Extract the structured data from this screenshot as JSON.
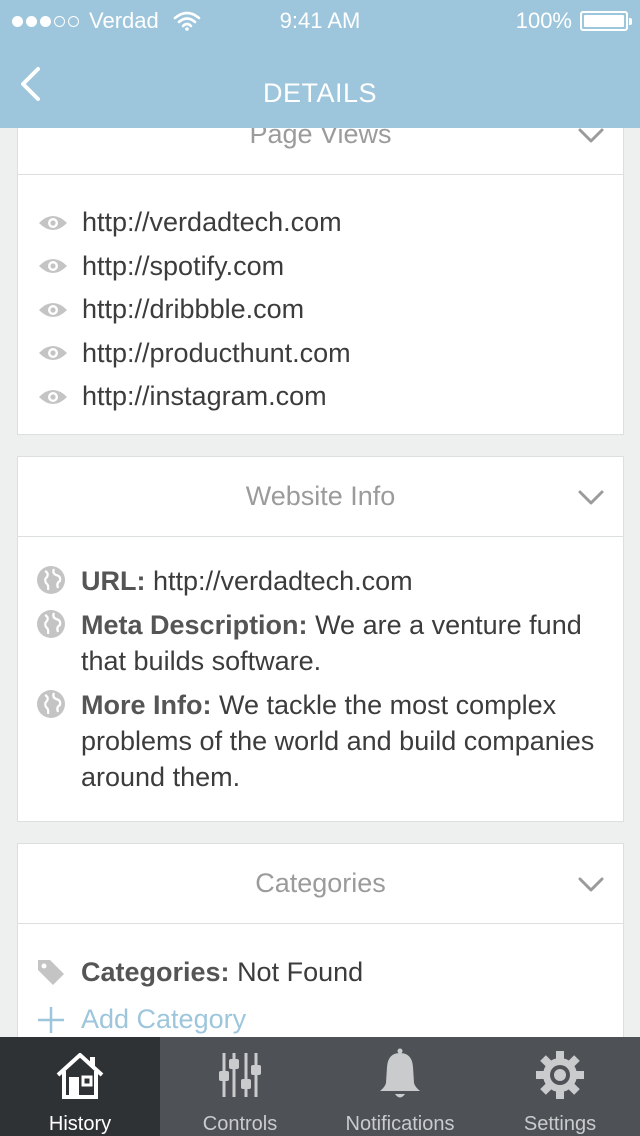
{
  "status_bar": {
    "carrier": "Verdad",
    "time": "9:41 AM",
    "battery": "100%",
    "signal_filled": 3,
    "signal_total": 5
  },
  "nav": {
    "title": "DETAILS"
  },
  "page_views": {
    "title": "Page Views",
    "items": [
      "http://verdadtech.com",
      "http://spotify.com",
      "http://dribbble.com",
      "http://producthunt.com",
      "http://instagram.com"
    ]
  },
  "website_info": {
    "title": "Website Info",
    "items": [
      {
        "label": "URL:",
        "value": "http://verdadtech.com"
      },
      {
        "label": "Meta Description:",
        "value": "We are a venture fund that builds software."
      },
      {
        "label": "More Info:",
        "value": "We tackle the most complex problems of the world and build companies around them."
      }
    ]
  },
  "categories": {
    "title": "Categories",
    "label": "Categories:",
    "value": "Not Found",
    "add_label": "Add Category"
  },
  "tabs": [
    {
      "label": "History",
      "icon": "home-icon",
      "active": true
    },
    {
      "label": "Controls",
      "icon": "sliders-icon",
      "active": false
    },
    {
      "label": "Notifications",
      "icon": "bell-icon",
      "active": false
    },
    {
      "label": "Settings",
      "icon": "gear-icon",
      "active": false
    }
  ],
  "colors": {
    "header": "#9dc6dc",
    "tab_bar": "#4e5256",
    "tab_active": "#2f3235",
    "accent": "#9dc6dc"
  }
}
